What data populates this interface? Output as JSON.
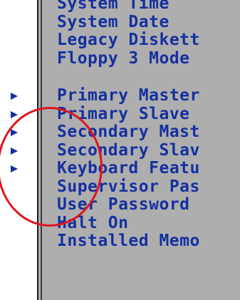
{
  "bios_menu": {
    "items": [
      {
        "label": "System Time",
        "submenu": false
      },
      {
        "label": "System Date",
        "submenu": false
      },
      {
        "label": "Legacy Diskett",
        "submenu": false
      },
      {
        "label": "Floppy 3 Mode",
        "submenu": false
      },
      {
        "label": "",
        "submenu": false
      },
      {
        "label": "Primary Master",
        "submenu": true
      },
      {
        "label": "Primary Slave",
        "submenu": true
      },
      {
        "label": "Secondary Mast",
        "submenu": true
      },
      {
        "label": "Secondary Slav",
        "submenu": true
      },
      {
        "label": "Keyboard Featu",
        "submenu": true
      },
      {
        "label": "Supervisor Pas",
        "submenu": false
      },
      {
        "label": "User Password",
        "submenu": false
      },
      {
        "label": "Halt On",
        "submenu": false
      },
      {
        "label": "Installed Memo",
        "submenu": false
      }
    ]
  },
  "colors": {
    "panel_background": "#aeaeae",
    "menu_text": "#1530a0",
    "highlight_circle": "#e0141e"
  }
}
